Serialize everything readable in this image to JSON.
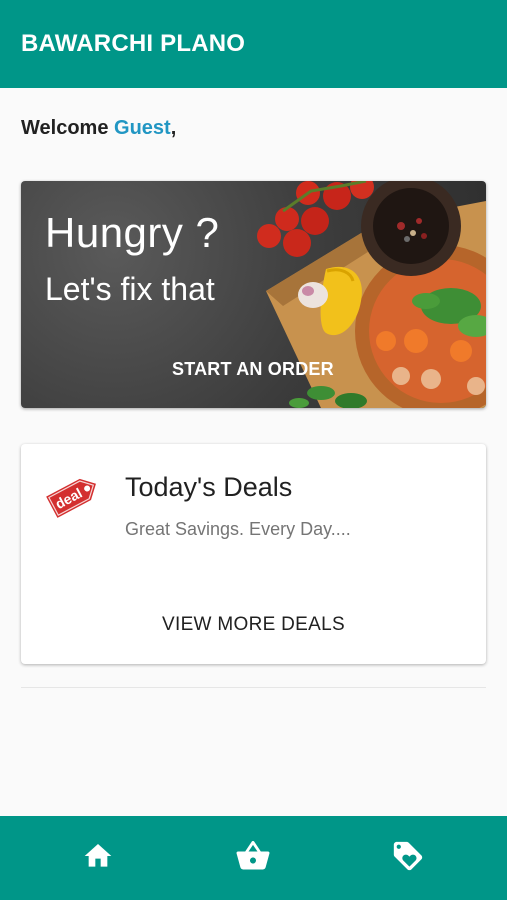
{
  "app": {
    "title": "BAWARCHI PLANO"
  },
  "welcome": {
    "prefix": "Welcome",
    "user": "Guest",
    "suffix": ","
  },
  "hero": {
    "headline": "Hungry ?",
    "subheadline": "Let's fix that",
    "cta_label": "START AN ORDER"
  },
  "deals": {
    "icon": "deal-tag-icon",
    "icon_text": "deal",
    "title": "Today's Deals",
    "subtitle": "Great Savings. Every Day....",
    "cta_label": "VIEW MORE DEALS"
  },
  "bottom_nav": {
    "items": [
      {
        "icon": "home-icon"
      },
      {
        "icon": "basket-icon"
      },
      {
        "icon": "tag-icon"
      }
    ]
  },
  "colors": {
    "primary": "#009688",
    "accent_text": "#2196c3",
    "deal_red": "#d32f2f"
  }
}
